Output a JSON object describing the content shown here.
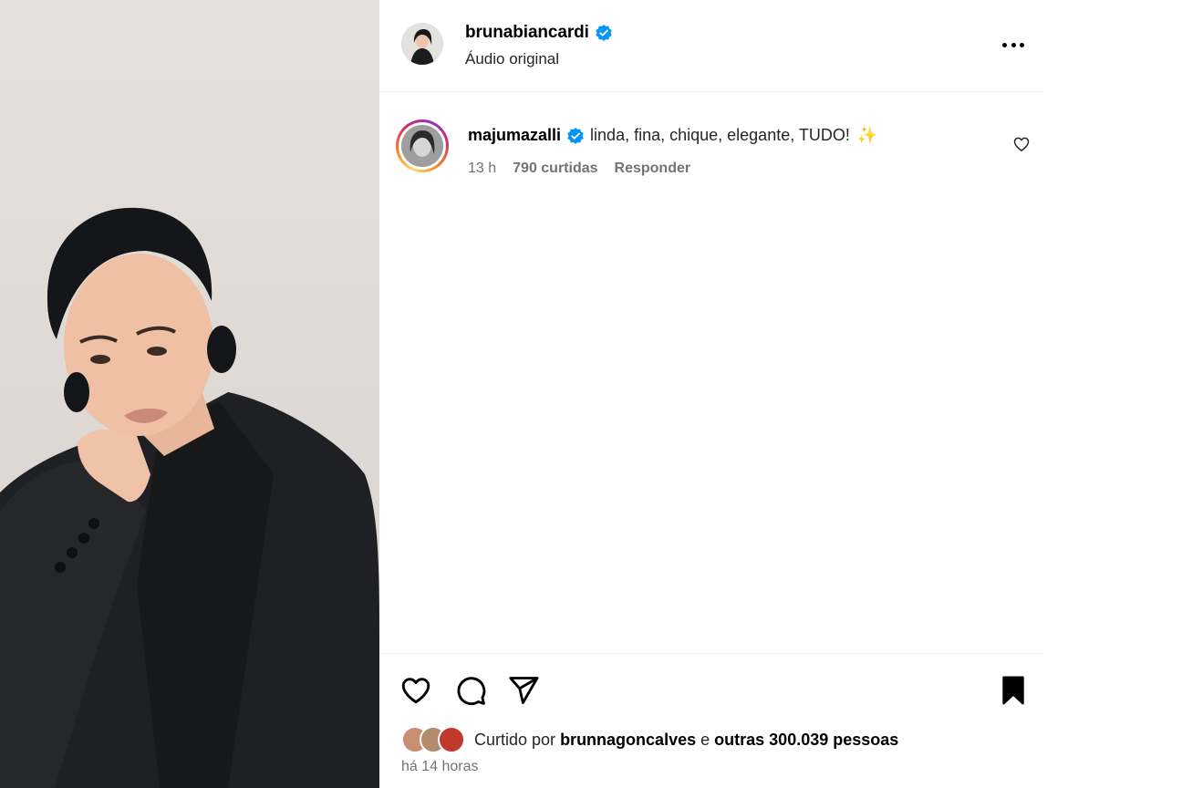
{
  "post": {
    "username": "brunabiancardi",
    "verified": true,
    "subtitle": "Áudio original",
    "more_icon": "more-horizontal-icon"
  },
  "comment": {
    "username": "majumazalli",
    "verified": true,
    "text": "linda, fina, chique, elegante, TUDO!",
    "emoji": "✨",
    "time": "13 h",
    "likes": "790 curtidas",
    "reply_label": "Responder"
  },
  "actions": {
    "like_icon": "heart-icon",
    "comment_icon": "comment-icon",
    "share_icon": "send-icon",
    "save_icon": "bookmark-filled-icon"
  },
  "likes": {
    "prefix": "Curtido por",
    "user": "brunnagoncalves",
    "connector": "e",
    "others": "outras 300.039 pessoas"
  },
  "timestamp": "há 14 horas",
  "colors": {
    "verified_blue": "#0095f6",
    "muted_text": "#737373",
    "divider": "#efefef"
  }
}
